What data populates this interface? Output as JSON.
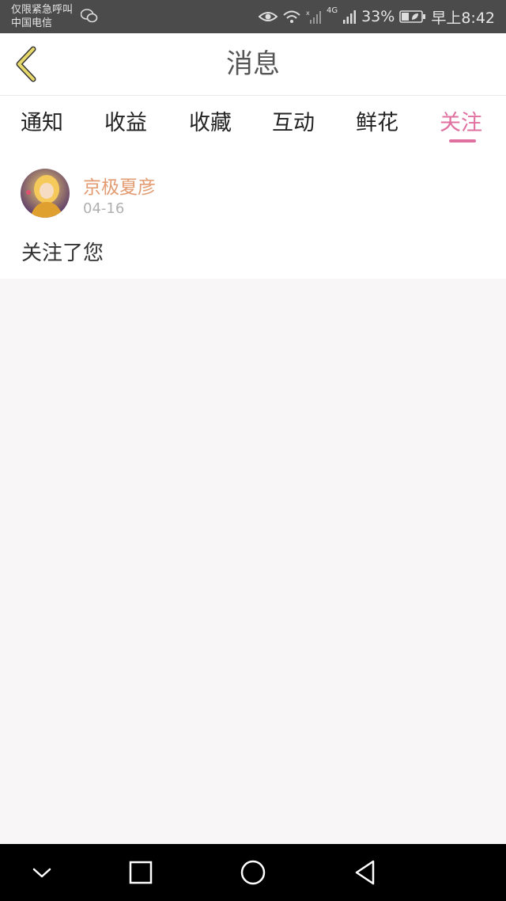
{
  "status_bar": {
    "line1": "仅限紧急呼叫",
    "line2": "中国电信",
    "network": "4G",
    "battery": "33%",
    "time": "早上8:42"
  },
  "header": {
    "title": "消息"
  },
  "tabs": [
    {
      "label": "通知"
    },
    {
      "label": "收益"
    },
    {
      "label": "收藏"
    },
    {
      "label": "互动"
    },
    {
      "label": "鲜花"
    },
    {
      "label": "关注"
    }
  ],
  "active_tab": "关注",
  "notification": {
    "username": "京极夏彦",
    "date": "04-16",
    "text": "关注了您"
  },
  "colors": {
    "accent": "#e070a0",
    "username": "#e39b72",
    "back_icon": "#e6d86a"
  }
}
